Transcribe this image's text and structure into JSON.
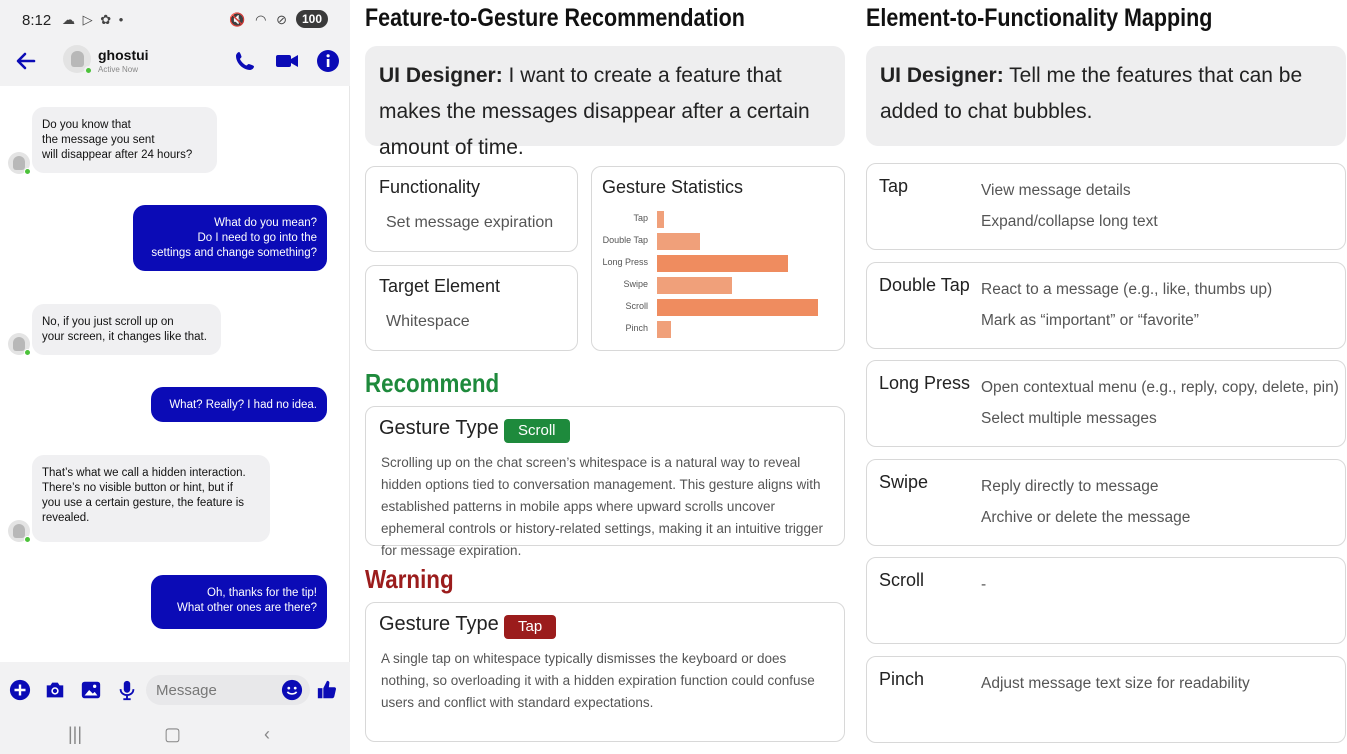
{
  "status_bar": {
    "time": "8:12",
    "left_icons": "☁ ▷ ✿ •",
    "right_icons": "🔇 ◠ ⊘",
    "battery": "100"
  },
  "chat_header": {
    "contact_name": "ghostui",
    "contact_status": "Active Now"
  },
  "messages": [
    {
      "side": "in",
      "text": "Do you know that\nthe message you sent\nwill disappear after 24 hours?"
    },
    {
      "side": "out",
      "text": "What do you mean?\nDo I need to go into the\nsettings and change something?"
    },
    {
      "side": "in",
      "text": "No, if you just scroll up on\nyour screen, it changes like that."
    },
    {
      "side": "out",
      "text": "What? Really? I had no idea."
    },
    {
      "side": "in",
      "text": "That’s what we call a hidden interaction.\nThere’s no visible button or hint, but if\nyou use a certain gesture, the feature is\nrevealed."
    },
    {
      "side": "out",
      "text": "Oh, thanks for the tip!\nWhat other ones are there?"
    }
  ],
  "composer": {
    "placeholder": "Message"
  },
  "feature_to_gesture": {
    "title": "Feature-to-Gesture Recommendation",
    "prompt_who": "UI Designer:",
    "prompt_text": " I want to create a feature that makes the messages disappear after a certain amount of time.",
    "functionality_title": "Functionality",
    "functionality_value": "Set message expiration",
    "target_title": "Target Element",
    "target_value": "Whitespace",
    "stats_title": "Gesture Statistics",
    "recommend_heading": "Recommend",
    "recommend_label": "Gesture Type",
    "recommend_badge": "Scroll",
    "recommend_desc": "Scrolling up on the chat screen’s whitespace is a natural way to reveal hidden options tied to conversation management. This gesture aligns with established patterns in mobile apps where upward scrolls uncover ephemeral controls or history-related settings, making it an intuitive trigger for message expiration.",
    "warning_heading": "Warning",
    "warning_label": "Gesture Type",
    "warning_badge": "Tap",
    "warning_desc": "A single tap on whitespace typically dismisses the keyboard or does nothing, so overloading it with a hidden expiration function could confuse users and conflict with standard expectations."
  },
  "chart_data": {
    "type": "bar",
    "orientation": "horizontal",
    "title": "Gesture Statistics",
    "categories": [
      "Tap",
      "Double Tap",
      "Long Press",
      "Swipe",
      "Scroll",
      "Pinch"
    ],
    "values": [
      5,
      33,
      100,
      57,
      123,
      11
    ],
    "xlim": [
      0,
      130
    ],
    "color": "#f0a07a",
    "highlight_colors": {
      "Long Press": "#ef8c5f",
      "Scroll": "#ef8c5f"
    }
  },
  "element_to_functionality": {
    "title": "Element-to-Functionality Mapping",
    "prompt_who": "UI Designer:",
    "prompt_text": " Tell me the features that can be added to chat bubbles.",
    "rows": [
      {
        "gesture": "Tap",
        "functions": [
          "View message details",
          "Expand/collapse long text"
        ]
      },
      {
        "gesture": "Double Tap",
        "functions": [
          "React to a message (e.g., like, thumbs up)",
          "Mark as “important” or “favorite”"
        ]
      },
      {
        "gesture": "Long Press",
        "functions": [
          "Open contextual menu (e.g., reply, copy, delete, pin)",
          "Select multiple messages"
        ]
      },
      {
        "gesture": "Swipe",
        "functions": [
          "Reply directly to message",
          "Archive or delete the message"
        ]
      },
      {
        "gesture": "Scroll",
        "functions": [
          "-"
        ]
      },
      {
        "gesture": "Pinch",
        "functions": [
          "Adjust message text size for readability"
        ]
      }
    ]
  },
  "colors": {
    "accent_blue": "#0b0bb6",
    "recommend_green": "#1e8a3c",
    "warning_red": "#9b1c1c",
    "bar_orange": "#f0a07a"
  }
}
